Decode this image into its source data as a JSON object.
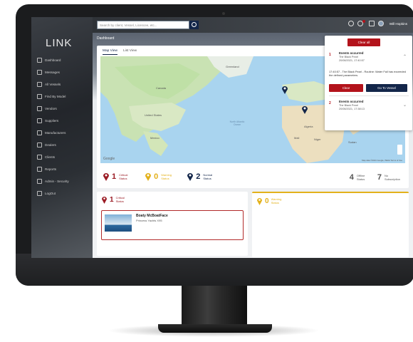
{
  "app": {
    "logo": "LINK"
  },
  "sidebar": {
    "items": [
      {
        "label": "Dashboard",
        "icon": "home-icon"
      },
      {
        "label": "Messages",
        "icon": "message-icon"
      },
      {
        "label": "All Vessels",
        "icon": "list-icon"
      },
      {
        "label": "Find By Model",
        "icon": "search-icon"
      },
      {
        "label": "Vendors",
        "icon": "box-icon"
      },
      {
        "label": "Suppliers",
        "icon": "truck-icon"
      },
      {
        "label": "Manufacturers",
        "icon": "wrench-icon"
      },
      {
        "label": "Dealers",
        "icon": "tag-icon"
      },
      {
        "label": "Clients",
        "icon": "users-icon"
      },
      {
        "label": "Reports",
        "icon": "report-icon"
      },
      {
        "label": "Admin - Security",
        "icon": "shield-icon"
      },
      {
        "label": "LogOut",
        "icon": "logout-icon"
      }
    ]
  },
  "topbar": {
    "search_placeholder": "Search by client, Vessel, Licencee, etc...",
    "user_name": "Will Hopkins"
  },
  "page": {
    "breadcrumb": "Dashboard",
    "tabs": [
      "Map View",
      "List View"
    ]
  },
  "map": {
    "attribution": "Map data ©2021 Google, INEGI  Terms of Use",
    "google_label": "Google",
    "labels": [
      "Canada",
      "United States",
      "Mexico",
      "North Atlantic Ocean",
      "Greenland",
      "Mali",
      "Niger",
      "Algeria",
      "Libya",
      "Egypt",
      "Saudi Arabia",
      "Sudan"
    ]
  },
  "stats": {
    "critical": {
      "count": "1",
      "label": "Critical Status",
      "color": "#9b1c25"
    },
    "warning": {
      "count": "0",
      "label": "Warning Status",
      "color": "#e3b11b"
    },
    "normal": {
      "count": "2",
      "label": "Normal Status",
      "color": "#13264a"
    },
    "offline": {
      "count": "4",
      "label": "Offline Status"
    },
    "no_subscription": {
      "count": "7",
      "label": "No Subscription"
    }
  },
  "cards": {
    "critical": {
      "count": "1",
      "label": "Critical Status"
    },
    "warning": {
      "count": "0",
      "label": "Warning Status"
    },
    "vessel": {
      "name": "Boaty McBoatFace",
      "company": "Princess Yachts X95"
    }
  },
  "notifications": {
    "clear_all": "Clear all",
    "events": [
      {
        "index": "1",
        "title": "Events occurred",
        "vessel": "The Black Pearl",
        "time": "20/08/2021, 17:40:57"
      },
      {
        "index": "2",
        "title": "Events occurred",
        "vessel": "The Black Pearl",
        "time": "20/08/2021, 17:38:13"
      }
    ],
    "message": "17:40:57 - The Black Pearl - Routine: Water Fall has exceeded the defined parameters.",
    "clear_btn": "Clear",
    "goto_btn": "Go To Vessel"
  },
  "colors": {
    "critical": "#9b1c25",
    "navy": "#13264a",
    "warning": "#e3b11b"
  }
}
